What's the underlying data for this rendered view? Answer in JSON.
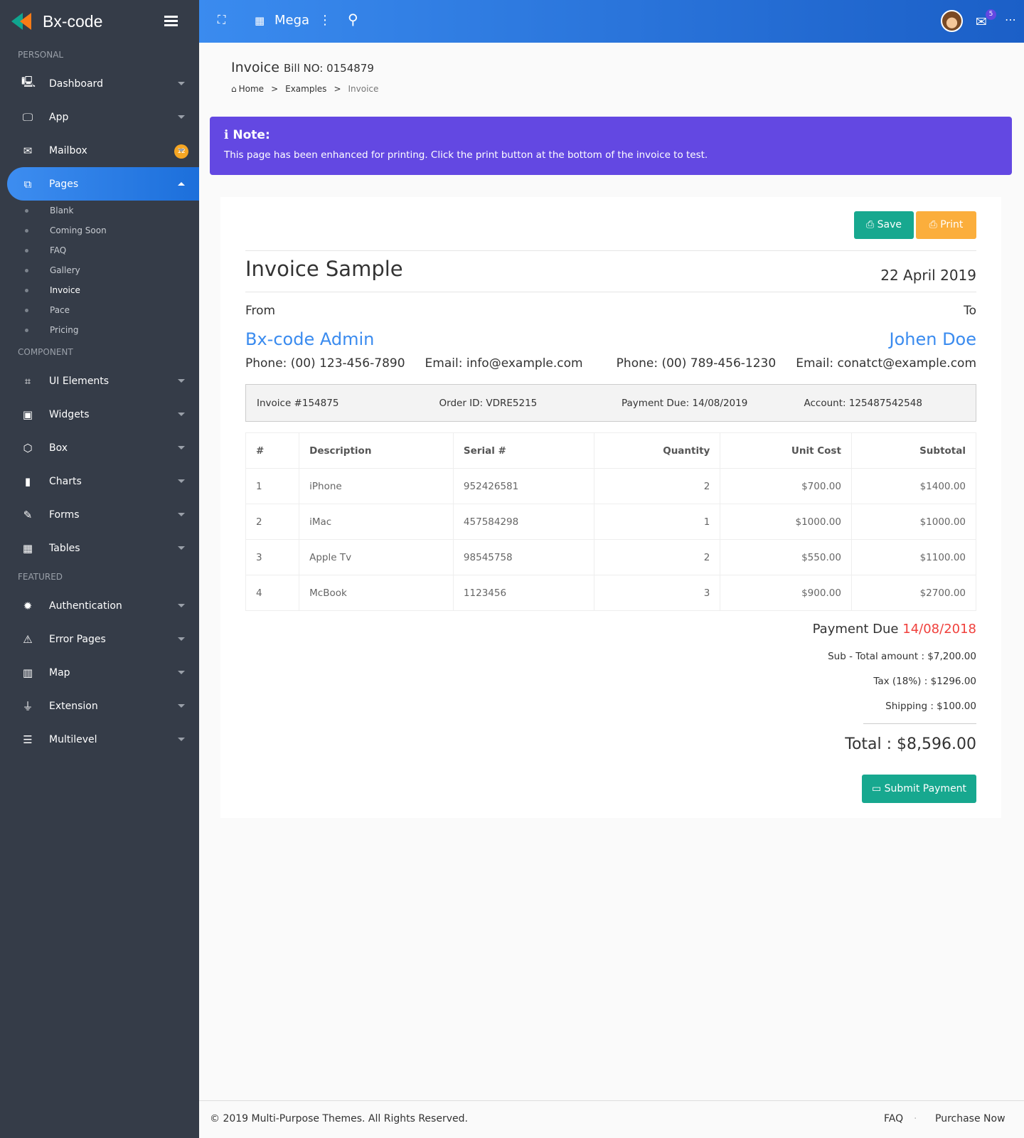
{
  "brand": "Bx-code",
  "sidebar": {
    "sections": [
      "PERSONAL",
      "COMPONENT",
      "FEATURED"
    ],
    "personal": [
      {
        "label": "Dashboard",
        "icon": "monitor-icon"
      },
      {
        "label": "App",
        "icon": "desktop-icon"
      },
      {
        "label": "Mailbox",
        "icon": "mail-icon",
        "badge": "12"
      },
      {
        "label": "Pages",
        "icon": "pages-icon"
      }
    ],
    "pages_sub": [
      "Blank",
      "Coming Soon",
      "FAQ",
      "Gallery",
      "Invoice",
      "Pace",
      "Pricing"
    ],
    "component": [
      {
        "label": "UI Elements",
        "icon": "crop-icon"
      },
      {
        "label": "Widgets",
        "icon": "image-icon"
      },
      {
        "label": "Box",
        "icon": "cube-icon"
      },
      {
        "label": "Charts",
        "icon": "bar-chart-icon"
      },
      {
        "label": "Forms",
        "icon": "pencil-icon"
      },
      {
        "label": "Tables",
        "icon": "grid-icon"
      }
    ],
    "featured": [
      {
        "label": "Authentication",
        "icon": "badge-icon"
      },
      {
        "label": "Error Pages",
        "icon": "warning-icon"
      },
      {
        "label": "Map",
        "icon": "map-icon"
      },
      {
        "label": "Extension",
        "icon": "plug-icon"
      },
      {
        "label": "Multilevel",
        "icon": "list-icon"
      }
    ]
  },
  "topbar": {
    "mega": "Mega",
    "mail_count": "5"
  },
  "page": {
    "title": "Invoice",
    "subtitle": "Bill NO: 0154879",
    "breadcrumb": [
      "Home",
      ">",
      "Examples",
      ">",
      "Invoice"
    ]
  },
  "note": {
    "title": "Note:",
    "text": "This page has been enhanced for printing. Click the print button at the bottom of the invoice to test."
  },
  "invoice": {
    "save": "Save",
    "print": "Print",
    "title": "Invoice Sample",
    "date": "22 April 2019",
    "from_label": "From",
    "to_label": "To",
    "from": {
      "name": "Bx-code Admin",
      "phone": "Phone: (00) 123-456-7890",
      "email": "Email: info@example.com"
    },
    "to": {
      "name": "Johen Doe",
      "phone": "Phone: (00) 789-456-1230",
      "email": "Email: conatct@example.com"
    },
    "info": [
      "Invoice #154875",
      "Order ID: VDRE5215",
      "Payment Due: 14/08/2019",
      "Account: 125487542548"
    ],
    "columns": [
      "#",
      "Description",
      "Serial #",
      "Quantity",
      "Unit Cost",
      "Subtotal"
    ],
    "rows": [
      [
        "1",
        "iPhone",
        "952426581",
        "2",
        "$700.00",
        "$1400.00"
      ],
      [
        "2",
        "iMac",
        "457584298",
        "1",
        "$1000.00",
        "$1000.00"
      ],
      [
        "3",
        "Apple Tv",
        "98545758",
        "2",
        "$550.00",
        "$1100.00"
      ],
      [
        "4",
        "McBook",
        "1123456",
        "3",
        "$900.00",
        "$2700.00"
      ]
    ],
    "payment_due_label": "Payment Due",
    "payment_due_date": "14/08/2018",
    "subtotal": "Sub - Total amount : $7,200.00",
    "tax": "Tax (18%) : $1296.00",
    "shipping": "Shipping : $100.00",
    "total": "Total : $8,596.00",
    "submit": "Submit Payment"
  },
  "footer": {
    "copyright": "© 2019 Multi-Purpose Themes. All Rights Reserved.",
    "faq": "FAQ",
    "purchase": "Purchase Now"
  },
  "colors": {
    "sidebar": "#353c48",
    "accent": "#3a8bef",
    "note": "#6348e2",
    "save": "#17a88f",
    "print": "#fbae3c",
    "due": "#f0403c"
  }
}
